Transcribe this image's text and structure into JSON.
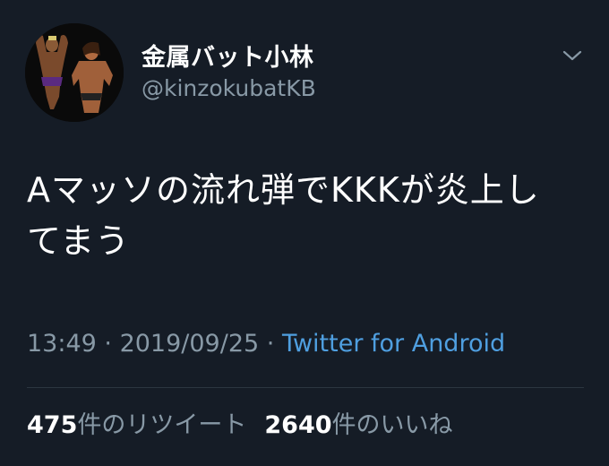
{
  "user": {
    "display_name": "金属バット小林",
    "handle": "@kinzokubatKB"
  },
  "tweet": {
    "text": "Aマッソの流れ弾でKKKが炎上し\nてまう",
    "time": "13:49",
    "separator": " · ",
    "date": "2019/09/25",
    "separator2": " · ",
    "source": "Twitter for Android"
  },
  "stats": {
    "retweets_count": "475",
    "retweets_label": "件のリツイート",
    "likes_count": "2640",
    "likes_label": "件のいいね"
  },
  "icons": {
    "menu": "chevron-down-icon",
    "avatar": "avatar"
  },
  "colors": {
    "background": "#151c26",
    "secondary_text": "#8899a6",
    "link": "#4f9fe0"
  }
}
